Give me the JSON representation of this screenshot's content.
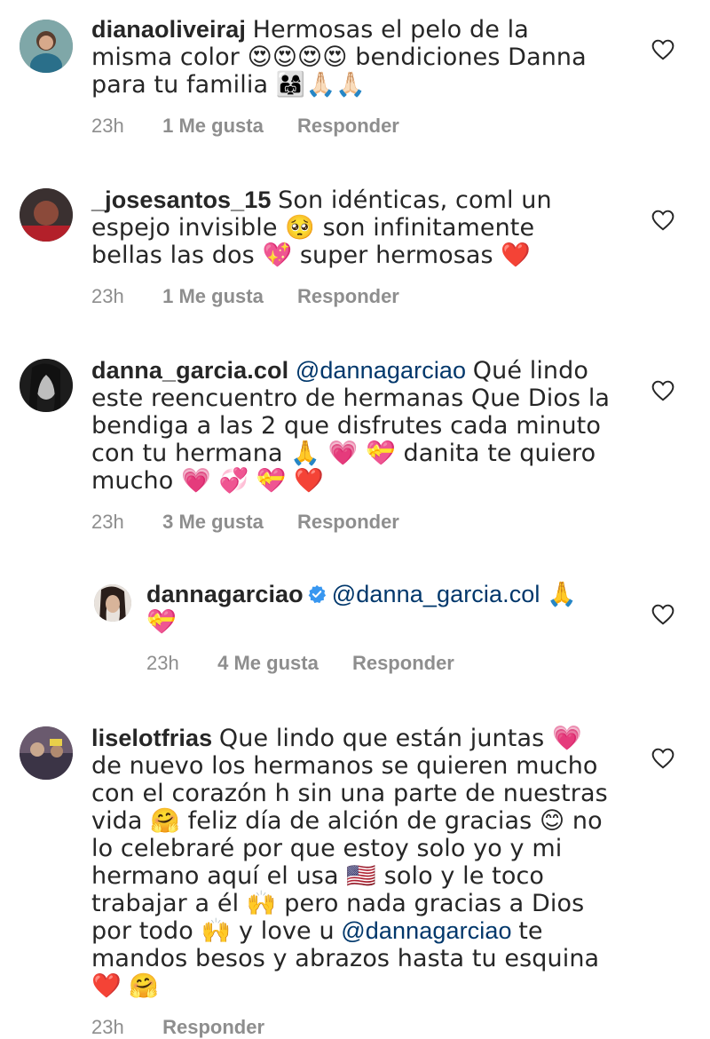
{
  "comments": [
    {
      "username": "dianaoliveiraj",
      "text": "Hermosas el pelo de la misma color 😍😍😍😍 bendiciones Danna para tu familia 👨‍👩‍👧🙏🏻🙏🏻",
      "time": "23h",
      "likes": "1 Me gusta",
      "reply": "Responder"
    },
    {
      "username": "_josesantos_15",
      "text": "Son idénticas, coml un espejo invisible 🥺 son infinitamente bellas las dos 💖 super hermosas ❤️",
      "time": "23h",
      "likes": "1 Me gusta",
      "reply": "Responder"
    },
    {
      "username": "danna_garcia.col",
      "mention": "@dannagarciao",
      "text": "Qué lindo este reencuentro de hermanas Que Dios la bendiga a las 2 que disfrutes cada minuto con tu hermana 🙏 💗 💝 danita te quiero mucho 💗 💞 💝 ❤️",
      "time": "23h",
      "likes": "3 Me gusta",
      "reply": "Responder"
    },
    {
      "username": "dannagarciao",
      "mention": "@danna_garcia.col",
      "text": "🙏 💝",
      "time": "23h",
      "likes": "4 Me gusta",
      "reply": "Responder"
    },
    {
      "username": "liselotfrias",
      "text_a": "Que lindo que están juntas 💗 de nuevo los hermanos se quieren mucho con el corazón h sin una parte de nuestras vida 🤗 feliz día de alción de gracias 😊 no lo celebraré por que estoy solo yo y mi hermano aquí el usa 🇺🇸 solo y le toco trabajar a él 🙌 pero nada gracias a Dios por todo 🙌 y love u",
      "mention": "@dannagarciao",
      "text_b": "te mandos besos y abrazos hasta tu esquina ❤️ 🤗",
      "time": "23h",
      "reply": "Responder"
    }
  ],
  "colors": {
    "text": "#262626",
    "meta": "#8e8e8e",
    "mention": "#00376b",
    "verified": "#3897f0"
  }
}
